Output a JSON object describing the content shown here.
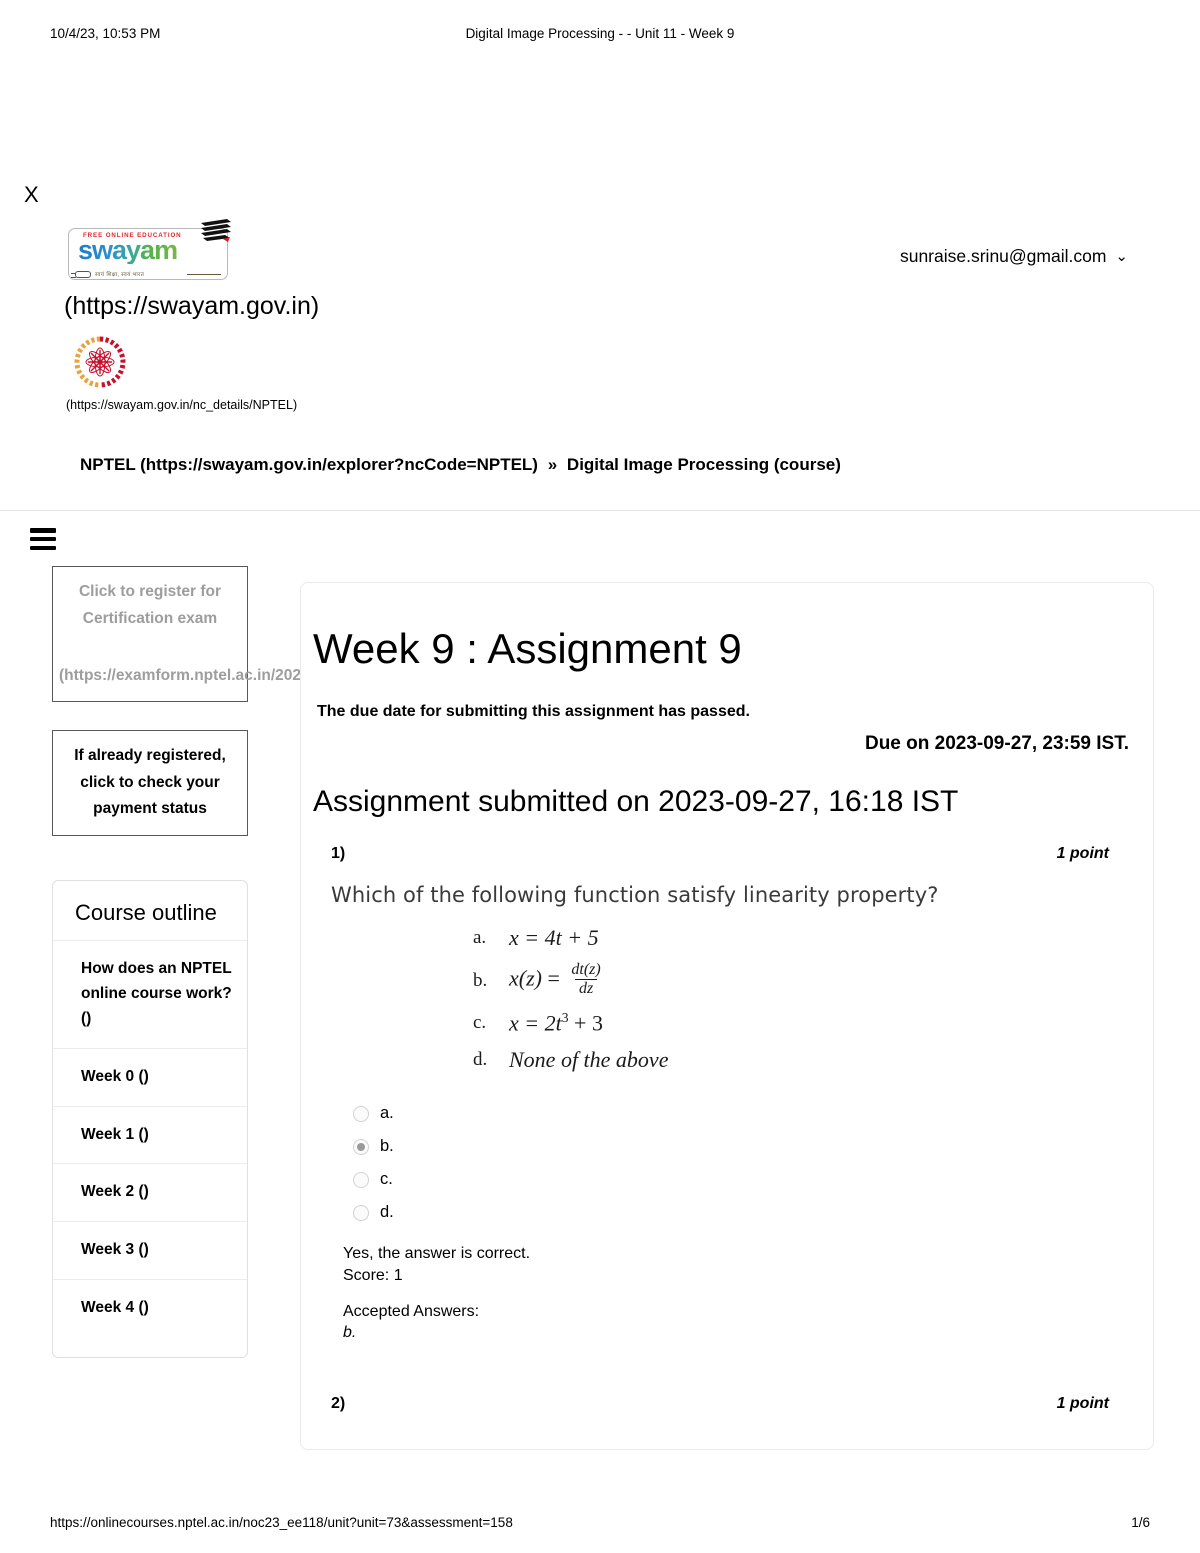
{
  "print_header": {
    "timestamp": "10/4/23, 10:53 PM",
    "doc_title": "Digital Image Processing - - Unit 11 - Week 9"
  },
  "close_label": "X",
  "branding": {
    "swayam_logo_tagline": "FREE ONLINE EDUCATION",
    "swayam_logo_word": "swayam",
    "swayam_logo_subtext": "स्वयं शिक्षा, स्वयं भारत",
    "swayam_url": "(https://swayam.gov.in)",
    "nptel_url": "(https://swayam.gov.in/nc_details/NPTEL)"
  },
  "account": {
    "email": "sunraise.srinu@gmail.com",
    "chevron": "⌄"
  },
  "breadcrumb": {
    "root": "NPTEL (https://swayam.gov.in/explorer?ncCode=NPTEL)",
    "separator": "»",
    "current": "Digital Image Processing (course)"
  },
  "sidebar": {
    "register_box": {
      "label": "Click to register for Certification exam",
      "url": "(https://examform.nptel.ac.in/2023_10/exam_form/dashboard)"
    },
    "payment_box": {
      "label": "If already registered, click to check your payment status"
    },
    "outline_title": "Course outline",
    "outline_items": [
      {
        "label": "How does an NPTEL online course work? ()"
      },
      {
        "label": "Week 0 ()"
      },
      {
        "label": "Week 1 ()"
      },
      {
        "label": "Week 2 ()"
      },
      {
        "label": "Week 3 ()"
      },
      {
        "label": "Week 4 ()"
      }
    ]
  },
  "assignment": {
    "title": "Week 9 : Assignment 9",
    "due_note": "The due date for submitting this assignment has passed.",
    "due_on": "Due on 2023-09-27, 23:59 IST.",
    "submitted": "Assignment submitted on 2023-09-27, 16:18 IST"
  },
  "questions": [
    {
      "number": "1)",
      "points": "1 point",
      "text": "Which of the following function satisfy linearity property?",
      "options": [
        {
          "letter": "a.",
          "body": "x = 4t + 5"
        },
        {
          "letter": "b.",
          "body": "x(z) = dt(z)/dz"
        },
        {
          "letter": "c.",
          "body": "x = 2t³ + 3"
        },
        {
          "letter": "d.",
          "body": "None of the above"
        }
      ],
      "choices": [
        {
          "label": "a.",
          "selected": false
        },
        {
          "label": "b.",
          "selected": true
        },
        {
          "label": "c.",
          "selected": false
        },
        {
          "label": "d.",
          "selected": false
        }
      ],
      "result_text": "Yes, the answer is correct.",
      "score_text": "Score: 1",
      "accepted_label": "Accepted Answers:",
      "accepted_value": "b."
    },
    {
      "number": "2)",
      "points": "1 point"
    }
  ],
  "math": {
    "opt_a_lhs": "x = 4t + 5",
    "opt_b_lhs": "x(z)",
    "opt_b_eq": "=",
    "opt_b_num": "dt(z)",
    "opt_b_den": "dz",
    "opt_c_lhs": "x = 2t",
    "opt_c_exp": "3",
    "opt_c_rhs": "+ 3",
    "opt_d": "None of the above"
  },
  "print_footer": {
    "url": "https://onlinecourses.nptel.ac.in/noc23_ee118/unit?unit=73&assessment=158",
    "page": "1/6"
  },
  "colors": {
    "swayam_red": "#e0262b",
    "swayam_blue": "#1f7ec4",
    "swayam_green": "#7ab648",
    "nptel_orange": "#e8a33d",
    "nptel_crimson": "#c8102e",
    "muted_text": "#9d9d9d"
  }
}
